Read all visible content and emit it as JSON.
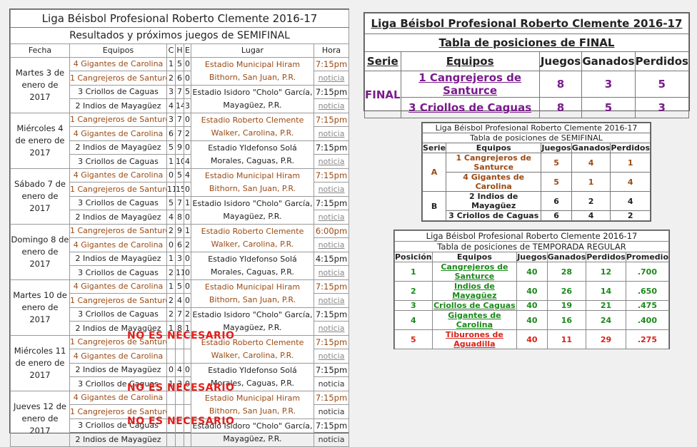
{
  "schedule": {
    "title": "Liga Béisbol Profesional Roberto Clemente 2016-17",
    "subtitle": "Resultados y próximos juegos de SEMIFINAL",
    "headers": {
      "fecha": "Fecha",
      "equipos": "Equipos",
      "c": "C",
      "h": "H",
      "e": "E",
      "lugar": "Lugar",
      "hora": "Hora"
    },
    "days": [
      {
        "date": "Martes 3 de enero de 2017",
        "rows": [
          {
            "team": "4 Gigantes de Carolina",
            "c": "1",
            "h": "5",
            "e": "0",
            "hora": "7:15pm",
            "color": "brown"
          },
          {
            "team": "1 Cangrejeros de Santurce",
            "c": "2",
            "h": "6",
            "e": "0",
            "hora": "noticia",
            "color": "brown"
          },
          {
            "team": "3 Criollos de Caguas",
            "c": "3",
            "h": "7",
            "e": "5",
            "hora": "7:15pm",
            "color": "dark"
          },
          {
            "team": "2 Indios de Mayagüez",
            "c": "4",
            "h": "14",
            "e": "3",
            "hora": "noticia",
            "color": "dark"
          }
        ],
        "venue1": "Estadio Municipal Hiram Bithorn, San Juan, P.R.",
        "venue2": "Estadio Isidoro \"Cholo\" García, Mayagüez, P.R."
      },
      {
        "date": "Miércoles 4 de enero de 2017",
        "rows": [
          {
            "team": "1 Cangrejeros de Santurce",
            "c": "3",
            "h": "7",
            "e": "0",
            "hora": "7:15pm",
            "color": "brown"
          },
          {
            "team": "4 Gigantes de Carolina",
            "c": "6",
            "h": "7",
            "e": "2",
            "hora": "noticia",
            "color": "brown"
          },
          {
            "team": "2 Indios de Mayagüez",
            "c": "5",
            "h": "9",
            "e": "0",
            "hora": "7:15pm",
            "color": "dark"
          },
          {
            "team": "3 Criollos de Caguas",
            "c": "1",
            "h": "10",
            "e": "4",
            "hora": "noticia",
            "color": "dark"
          }
        ],
        "venue1": "Estadio Roberto Clemente Walker, Carolina, P.R.",
        "venue2": "Estadio Yldefonso Solá Morales, Caguas, P.R."
      },
      {
        "date": "Sábado 7 de enero de 2017",
        "rows": [
          {
            "team": "4 Gigantes de Carolina",
            "c": "0",
            "h": "5",
            "e": "4",
            "hora": "7:15pm",
            "color": "brown"
          },
          {
            "team": "1 Cangrejeros de Santurce",
            "c": "11",
            "h": "15",
            "e": "0",
            "hora": "noticia",
            "color": "brown"
          },
          {
            "team": "3 Criollos de Caguas",
            "c": "5",
            "h": "7",
            "e": "1",
            "hora": "7:15pm",
            "color": "dark"
          },
          {
            "team": "2 Indios de Mayagüez",
            "c": "4",
            "h": "8",
            "e": "0",
            "hora": "noticia",
            "color": "dark"
          }
        ],
        "venue1": "Estadio Municipal Hiram Bithorn, San Juan, P.R.",
        "venue2": "Estadio Isidoro \"Cholo\" García, Mayagüez, P.R."
      },
      {
        "date": "Domingo 8 de enero de 2017",
        "rows": [
          {
            "team": "1 Cangrejeros de Santurce",
            "c": "2",
            "h": "9",
            "e": "1",
            "hora": "6:00pm",
            "color": "brown"
          },
          {
            "team": "4 Gigantes de Carolina",
            "c": "0",
            "h": "6",
            "e": "2",
            "hora": "noticia",
            "color": "brown"
          },
          {
            "team": "2 Indios de Mayagüez",
            "c": "1",
            "h": "3",
            "e": "0",
            "hora": "4:15pm",
            "color": "dark"
          },
          {
            "team": "3 Criollos de Caguas",
            "c": "2",
            "h": "11",
            "e": "0",
            "hora": "noticia",
            "color": "dark"
          }
        ],
        "venue1": "Estadio Roberto Clemente Walker, Carolina, P.R.",
        "venue2": "Estadio Yldefonso Solá Morales, Caguas, P.R."
      },
      {
        "date": "Martes 10 de enero de 2017",
        "rows": [
          {
            "team": "4 Gigantes de Carolina",
            "c": "1",
            "h": "5",
            "e": "0",
            "hora": "7:15pm",
            "color": "brown"
          },
          {
            "team": "1 Cangrejeros de Santurce",
            "c": "2",
            "h": "4",
            "e": "0",
            "hora": "noticia",
            "color": "brown"
          },
          {
            "team": "3 Criollos de Caguas",
            "c": "2",
            "h": "7",
            "e": "2",
            "hora": "7:15pm",
            "color": "dark"
          },
          {
            "team": "2 Indios de Mayagüez",
            "c": "1",
            "h": "8",
            "e": "1",
            "hora": "noticia",
            "color": "dark"
          }
        ],
        "venue1": "Estadio Municipal Hiram Bithorn, San Juan, P.R.",
        "venue2": "Estadio Isidoro \"Cholo\" García, Mayagüez, P.R."
      },
      {
        "date": "Miércoles 11 de enero de 2017",
        "rows": [
          {
            "team": "1 Cangrejeros de Santurce",
            "c": "",
            "h": "",
            "e": "",
            "hora": "7:15pm",
            "color": "brown"
          },
          {
            "team": "4 Gigantes de Carolina",
            "c": "",
            "h": "",
            "e": "",
            "hora": "noticia",
            "color": "brown"
          },
          {
            "team": "2 Indios de Mayagüez",
            "c": "0",
            "h": "4",
            "e": "0",
            "hora": "7:15pm",
            "color": "dark"
          },
          {
            "team": "3 Criollos de Caguas",
            "c": "1",
            "h": "3",
            "e": "0",
            "hora": "noticia",
            "color": "dark"
          }
        ],
        "venue1": "Estadio Roberto Clemente Walker, Carolina, P.R.",
        "venue2": "Estadio Yldefonso Solá Morales, Caguas, P.R."
      },
      {
        "date": "Jueves 12 de enero de 2017",
        "rows": [
          {
            "team": "4 Gigantes de Carolina",
            "c": "",
            "h": "",
            "e": "",
            "hora": "7:15pm",
            "color": "brown"
          },
          {
            "team": "1 Cangrejeros de Santurce",
            "c": "",
            "h": "",
            "e": "",
            "hora": "noticia",
            "color": "brown"
          },
          {
            "team": "3 Criollos de Caguas",
            "c": "",
            "h": "",
            "e": "",
            "hora": "7:15pm",
            "color": "dark"
          },
          {
            "team": "2 Indios de Mayagüez",
            "c": "",
            "h": "",
            "e": "",
            "hora": "noticia",
            "color": "dark"
          }
        ],
        "venue1": "Estadio Municipal Hiram Bithorn, San Juan, P.R.",
        "venue2": "Estadio Isidoro \"Cholo\" García, Mayagüez, P.R."
      }
    ],
    "not_necessary": "NO ES NECESARIO"
  },
  "final": {
    "title": "Liga Béisbol Profesional Roberto Clemente 2016-17",
    "subtitle": "Tabla de posiciones de FINAL",
    "headers": {
      "serie": "Serie",
      "equipos": "Equipos",
      "juegos": "Juegos",
      "ganados": "Ganados",
      "perdidos": "Perdidos"
    },
    "serie": "FINAL",
    "rows": [
      {
        "team": "1 Cangrejeros de Santurce",
        "juegos": "8",
        "ganados": "3",
        "perdidos": "5"
      },
      {
        "team": "3 Criollos de Caguas",
        "juegos": "8",
        "ganados": "5",
        "perdidos": "3"
      }
    ]
  },
  "semi": {
    "title": "Liga Béisbol Profesional Roberto Clemente 2016-17",
    "subtitle": "Tabla de posiciones de SEMIFINAL",
    "headers": {
      "serie": "Serie",
      "equipos": "Equipos",
      "juegos": "Juegos",
      "ganados": "Ganados",
      "perdidos": "Perdidos"
    },
    "groups": [
      {
        "serie": "A",
        "rows": [
          {
            "team": "1 Cangrejeros de Santurce",
            "juegos": "5",
            "ganados": "4",
            "perdidos": "1"
          },
          {
            "team": "4 Gigantes de Carolina",
            "juegos": "5",
            "ganados": "1",
            "perdidos": "4"
          }
        ]
      },
      {
        "serie": "B",
        "rows": [
          {
            "team": "2 Indios de Mayagüez",
            "juegos": "6",
            "ganados": "2",
            "perdidos": "4"
          },
          {
            "team": "3 Criollos de Caguas",
            "juegos": "6",
            "ganados": "4",
            "perdidos": "2"
          }
        ]
      }
    ]
  },
  "regular": {
    "title": "Liga Béisbol Profesional Roberto Clemente 2016-17",
    "subtitle": "Tabla de posiciones de TEMPORADA REGULAR",
    "headers": {
      "posicion": "Posición",
      "equipos": "Equipos",
      "juegos": "Juegos",
      "ganados": "Ganados",
      "perdidos": "Perdidos",
      "promedio": "Promedio"
    },
    "rows": [
      {
        "pos": "1",
        "team": "Cangrejeros de Santurce",
        "juegos": "40",
        "ganados": "28",
        "perdidos": "12",
        "promedio": ".700"
      },
      {
        "pos": "2",
        "team": "Indios de Mayagüez",
        "juegos": "40",
        "ganados": "26",
        "perdidos": "14",
        "promedio": ".650"
      },
      {
        "pos": "3",
        "team": "Criollos de Caguas",
        "juegos": "40",
        "ganados": "19",
        "perdidos": "21",
        "promedio": ".475"
      },
      {
        "pos": "4",
        "team": "Gigantes de Carolina",
        "juegos": "40",
        "ganados": "16",
        "perdidos": "24",
        "promedio": ".400"
      },
      {
        "pos": "5",
        "team": "Tiburones de Aguadilla",
        "juegos": "40",
        "ganados": "11",
        "perdidos": "29",
        "promedio": ".275"
      }
    ]
  },
  "colors": {
    "brown": "#9a4a14",
    "purple": "#7a1a8c",
    "green": "#1a8a1a",
    "red": "#d8231c"
  }
}
